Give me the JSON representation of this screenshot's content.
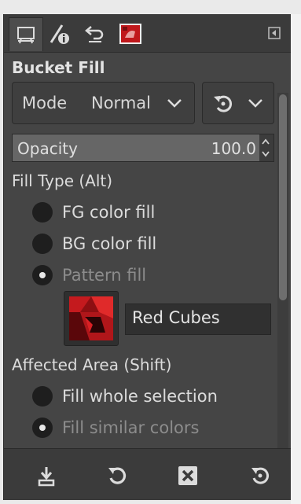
{
  "tabs": [
    {
      "icon": "tool-options-icon",
      "active": true
    },
    {
      "icon": "pointer-info-icon",
      "active": false
    },
    {
      "icon": "undo-history-icon",
      "active": false
    },
    {
      "icon": "image-thumbnail-icon",
      "active": false
    }
  ],
  "header": {
    "title": "Bucket Fill"
  },
  "mode": {
    "label": "Mode",
    "value": "Normal"
  },
  "opacity": {
    "label": "Opacity",
    "value": "100.0",
    "percent": 100
  },
  "fill_type": {
    "heading": "Fill Type  (Alt)",
    "options": [
      {
        "label": "FG color fill",
        "selected": false
      },
      {
        "label": "BG color fill",
        "selected": false
      },
      {
        "label": "Pattern fill",
        "selected": true
      }
    ]
  },
  "pattern": {
    "name": "Red Cubes"
  },
  "affected_area": {
    "heading": "Affected Area  (Shift)",
    "options": [
      {
        "label": "Fill whole selection",
        "selected": false
      },
      {
        "label": "Fill similar colors",
        "selected": true
      }
    ]
  },
  "bottom_buttons": [
    {
      "icon": "save-options-icon"
    },
    {
      "icon": "restore-icon"
    },
    {
      "icon": "delete-icon"
    },
    {
      "icon": "reset-icon"
    }
  ],
  "colors": {
    "panel": "#454545",
    "dark": "#3b3b3b",
    "pattern_red": "#c0181c"
  }
}
